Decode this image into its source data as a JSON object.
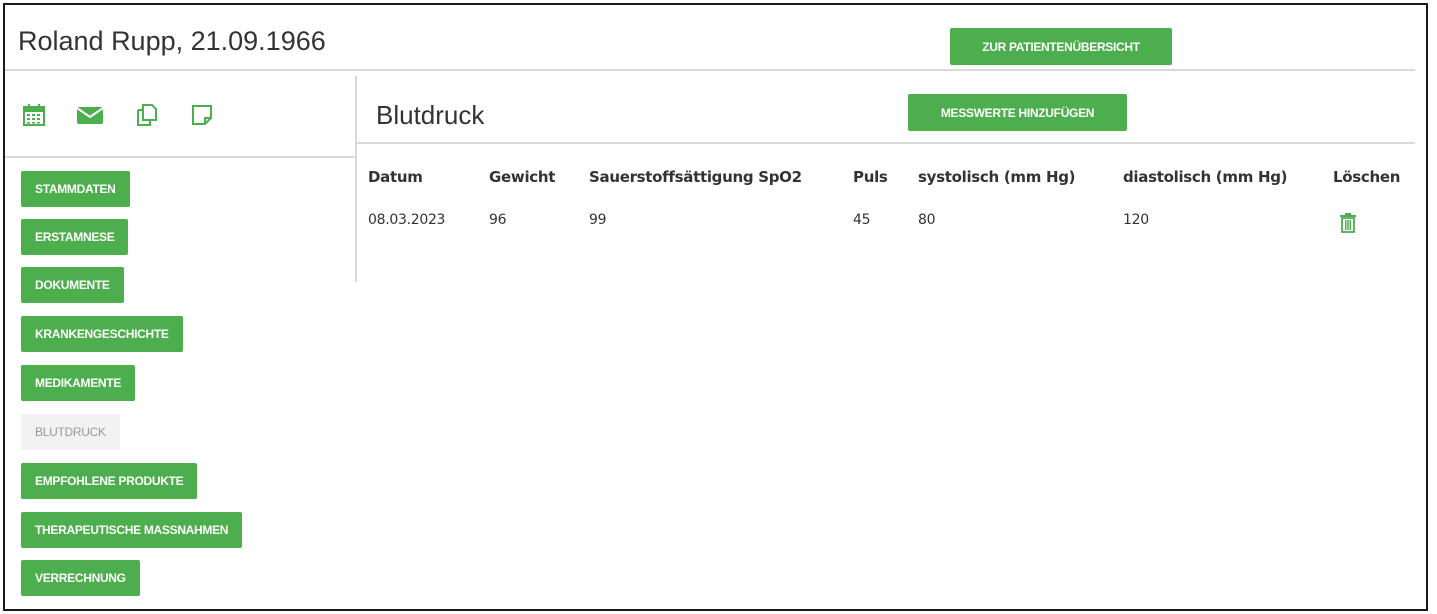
{
  "header": {
    "patient_name": "Roland Rupp, 21.09.1966",
    "overview_button": "ZUR PATIENTENÜBERSICHT"
  },
  "toolbar_icons": [
    "calendar-icon",
    "envelope-icon",
    "copy-icon",
    "note-icon"
  ],
  "sidebar": {
    "items": [
      {
        "label": "STAMMDATEN",
        "active": false
      },
      {
        "label": "ERSTAMNESE",
        "active": false
      },
      {
        "label": "DOKUMENTE",
        "active": false
      },
      {
        "label": "KRANKENGESCHICHTE",
        "active": false
      },
      {
        "label": "MEDIKAMENTE",
        "active": false
      },
      {
        "label": "BLUTDRUCK",
        "active": true
      },
      {
        "label": "EMPFOHLENE PRODUKTE",
        "active": false
      },
      {
        "label": "THERAPEUTISCHE MASSNAHMEN",
        "active": false
      },
      {
        "label": "VERRECHNUNG",
        "active": false
      }
    ]
  },
  "main": {
    "title": "Blutdruck",
    "add_button": "MESSWERTE HINZUFÜGEN",
    "table": {
      "columns": [
        "Datum",
        "Gewicht",
        "Sauerstoffsättigung SpO2",
        "Puls",
        "systolisch (mm Hg)",
        "diastolisch (mm Hg)",
        "Löschen"
      ],
      "rows": [
        [
          "08.03.2023",
          "96",
          "99",
          "45",
          "80",
          "120"
        ]
      ]
    }
  },
  "colors": {
    "accent": "#4cae4c",
    "active_bg": "#f2f2f2",
    "text": "#333333"
  }
}
